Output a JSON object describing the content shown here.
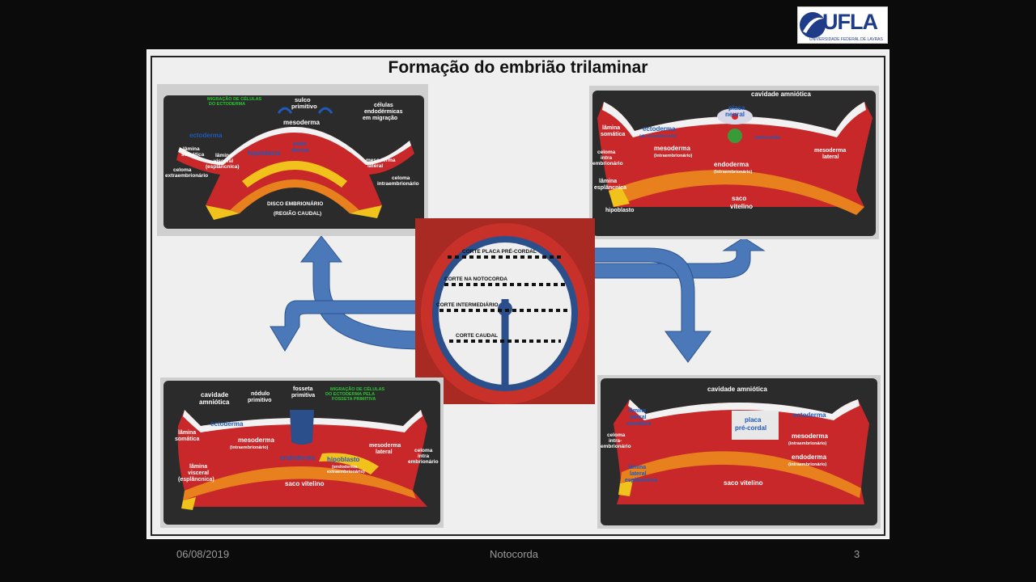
{
  "slide": {
    "title": "Formação do embrião trilaminar"
  },
  "logo": {
    "text": "UFLA",
    "subtitle": "UNIVERSIDADE FEDERAL DE LAVRAS"
  },
  "footer": {
    "date": "06/08/2019",
    "center": "Notocorda",
    "page": "3"
  },
  "panels": {
    "top_left": {
      "migration": "MIGRAÇÃO DE CÉLULAS\nDO ECTODERMA",
      "sulco": "sulco\nprimitivo",
      "celulas": "células\nendodérmicas\nem migração",
      "mesoderma": "mesoderma",
      "ectoderma": "ectoderma",
      "lamina_somatica": "lâmina\nsomática",
      "lamina_visceral": "lâmina\nvisceral\n(esplâncnica)",
      "hipoblasto": "hipoblasto",
      "endoderma": "endo\nderma",
      "celoma_extra": "celoma\nextraembrionário",
      "mesoderma_lateral": "mesoderma\nlateral",
      "celoma_intra": "celoma\nintraembrionário",
      "disco": "DISCO EMBRIONÁRIO\n(REGIÃO CAUDAL)"
    },
    "top_right": {
      "cavidade": "cavidade amniótica",
      "placa_neural": "placa\nneural",
      "notocorda": "notocorda",
      "lamina_somatica": "lâmina\nsomática",
      "ectoderma": "ectoderma",
      "revestimento": "(de revestimento)",
      "celoma": "celoma\nintra\nembrionário",
      "mesoderma": "mesoderma",
      "intraembrionario": "(intraembrionário)",
      "mesoderma_lateral": "mesoderma\nlateral",
      "lamina_esplancnica": "lâmina\nesplâncnica",
      "endoderma": "endoderma",
      "endo_intra": "(intraembrionário)",
      "hipoblasto": "hipoblasto",
      "saco": "saco\nvitelino"
    },
    "center": {
      "corte_placa": "CORTE PLACA PRÉ-CORDAL",
      "corte_notocorda": "CORTE NA NOTOCORDA",
      "corte_intermediario": "CORTE INTERMEDIÁRIO",
      "corte_caudal": "CORTE CAUDAL"
    },
    "bottom_left": {
      "cavidade": "cavidade\namniótica",
      "nodulo": "nódulo\nprimitivo",
      "fosseta": "fosseta\nprimitiva",
      "migration": "MIGRAÇÃO DE CÉLULAS\nDO ECTODERMA PELA\nFOSSETA PRIMITIVA",
      "ectoderma": "ectoderma",
      "lamina_somatica": "lâmina\nsomática",
      "mesoderma": "mesoderma",
      "intraembrionario": "(intraembrionário)",
      "mesoderma_lateral": "mesoderma\nlateral",
      "celoma": "celoma\nintra\nembrionário",
      "endoderma": "endoderma",
      "hipoblasto": "hipoblasto",
      "hipo_sub": "(endoderma\nextraembrionário)",
      "lamina_visceral": "lâmina\nvisceral\n(esplâncnica)",
      "saco": "saco vitelino"
    },
    "bottom_right": {
      "cavidade": "cavidade amniótica",
      "lamina": "lâmina\nlateral\nsomática",
      "ectoderma": "ectoderma",
      "placa": "placa\npré-cordal",
      "mesoderma": "mesoderma",
      "intraembrionario": "(intraembrionário)",
      "celoma": "celoma\nintra-\nembrionário",
      "endoderma": "endoderma",
      "endo_intra": "(intraembrionário)",
      "lamina_esplancnica": "lâmina\nlateral\nesplâncnica",
      "saco": "saco vitelino"
    }
  },
  "colors": {
    "slide_bg": "#efefef",
    "arrow": "#4a78b8",
    "mesoderm": "#c8282a",
    "endoderm": "#e8801e",
    "ectoderm": "#f2f2f2",
    "yolk": "#f2c21c",
    "board": "#2b2b2b"
  }
}
